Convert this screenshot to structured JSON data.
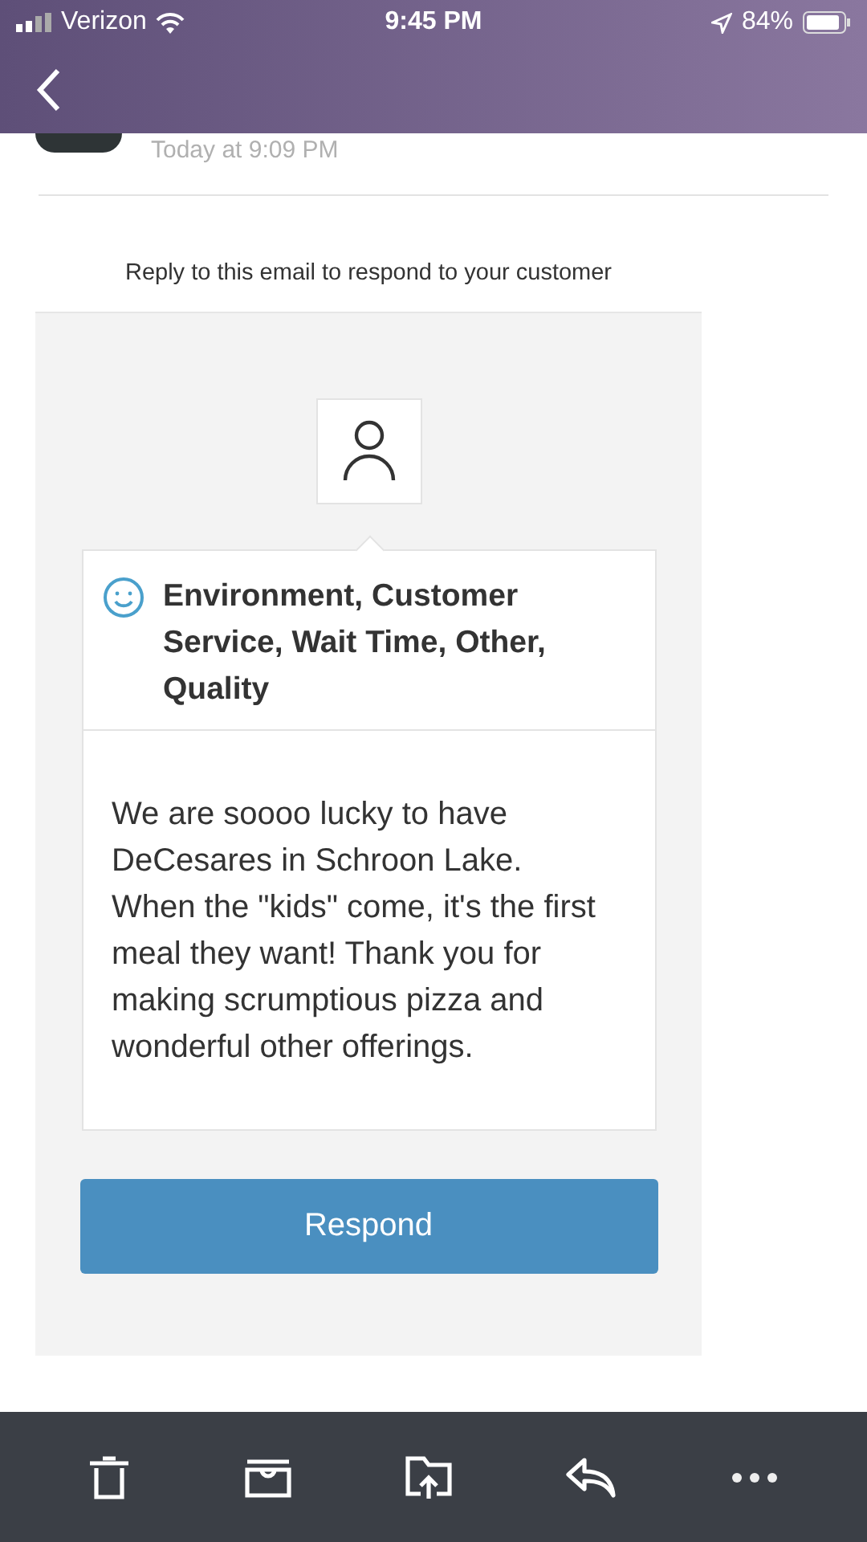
{
  "status_bar": {
    "carrier": "Verizon",
    "time": "9:45 PM",
    "battery": "84%"
  },
  "message": {
    "timestamp": "Today at 9:09 PM"
  },
  "note": "Reply to this email to respond to your customer",
  "review": {
    "categories": "Environment, Customer Service, Wait Time, Other, Quality",
    "body": "We are soooo lucky to have DeCesares in Schroon Lake. When the \"kids\" come, it's the first meal they want! Thank you for making scrumptious pizza and wonderful other offerings."
  },
  "respond_button": "Respond"
}
